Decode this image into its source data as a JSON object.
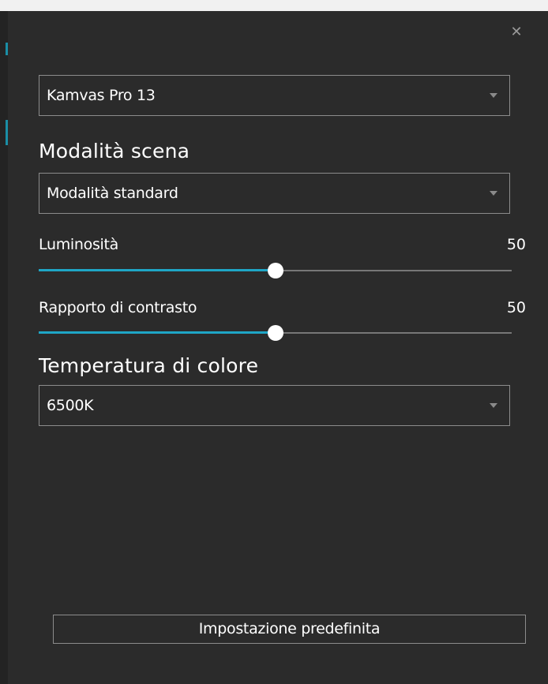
{
  "device_select": {
    "value": "Kamvas Pro 13",
    "icon": "dropdown-arrow-icon"
  },
  "scene_mode": {
    "heading": "Modalità scena",
    "select_value": "Modalità standard"
  },
  "brightness": {
    "label": "Luminosità",
    "value": "50",
    "level": 50
  },
  "contrast": {
    "label": "Rapporto di contrasto",
    "value": "50",
    "level": 50
  },
  "color_temp": {
    "heading": "Temperatura di colore",
    "select_value": "6500K"
  },
  "reset_button": {
    "label": "Impostazione predefinita"
  },
  "close": {
    "glyph": "✕",
    "icon": "close-icon"
  },
  "colors": {
    "background": "#2b2b2b",
    "accent": "#1fa6c6",
    "border": "#8c8c8c",
    "text": "#ffffff"
  }
}
